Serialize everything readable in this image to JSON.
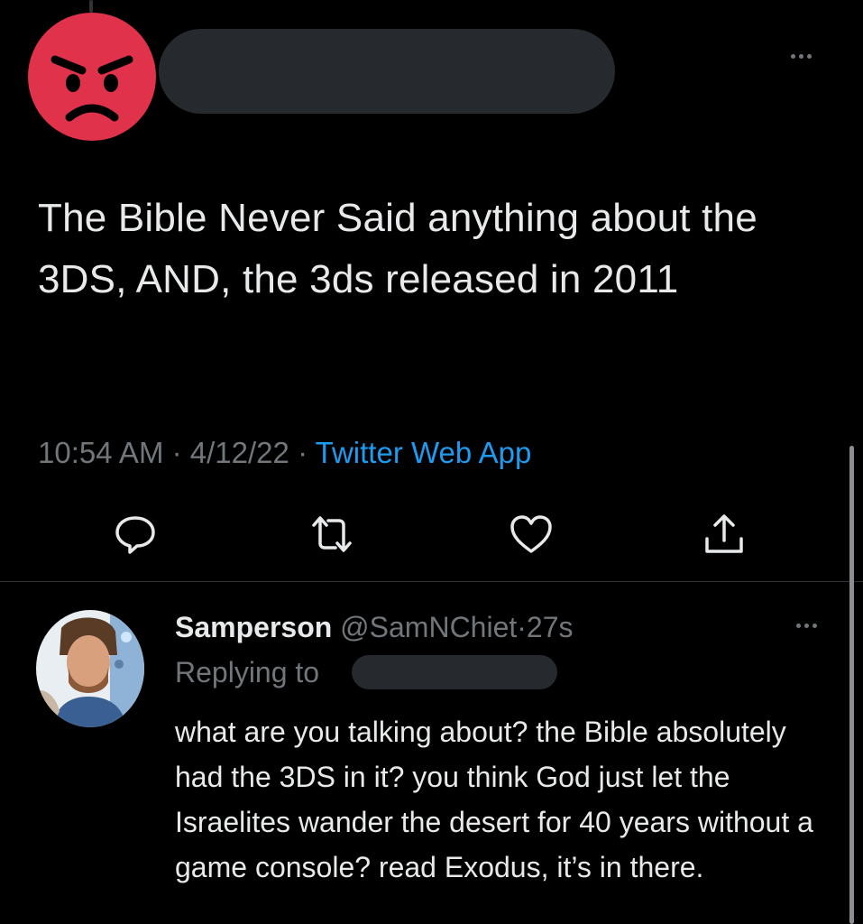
{
  "tweet": {
    "text": "The Bible Never Said anything about the 3DS, AND, the 3ds released in 2011",
    "time": "10:54 AM",
    "date": "4/12/22",
    "separator": "·",
    "source": "Twitter Web App",
    "avatar_icon": "angry-face-icon",
    "avatar_color": "#e0324b"
  },
  "actions": {
    "reply_icon": "reply-icon",
    "retweet_icon": "retweet-icon",
    "like_icon": "heart-icon",
    "share_icon": "share-icon"
  },
  "reply": {
    "display_name": "Samperson",
    "handle": "@SamNChiet",
    "time_ago": "27s",
    "separator": "·",
    "replying_to_label": "Replying to",
    "text": "what are you talking about? the Bible absolutely had the 3DS in it? you think God just let the Israelites wander the desert for 40 years without a game console? read Exodus, it’s in there."
  },
  "colors": {
    "background": "#000000",
    "text_primary": "#e7e9ea",
    "text_secondary": "#71767b",
    "link": "#1d9bf0",
    "divider": "#2f3336",
    "redaction": "#262a2e"
  }
}
